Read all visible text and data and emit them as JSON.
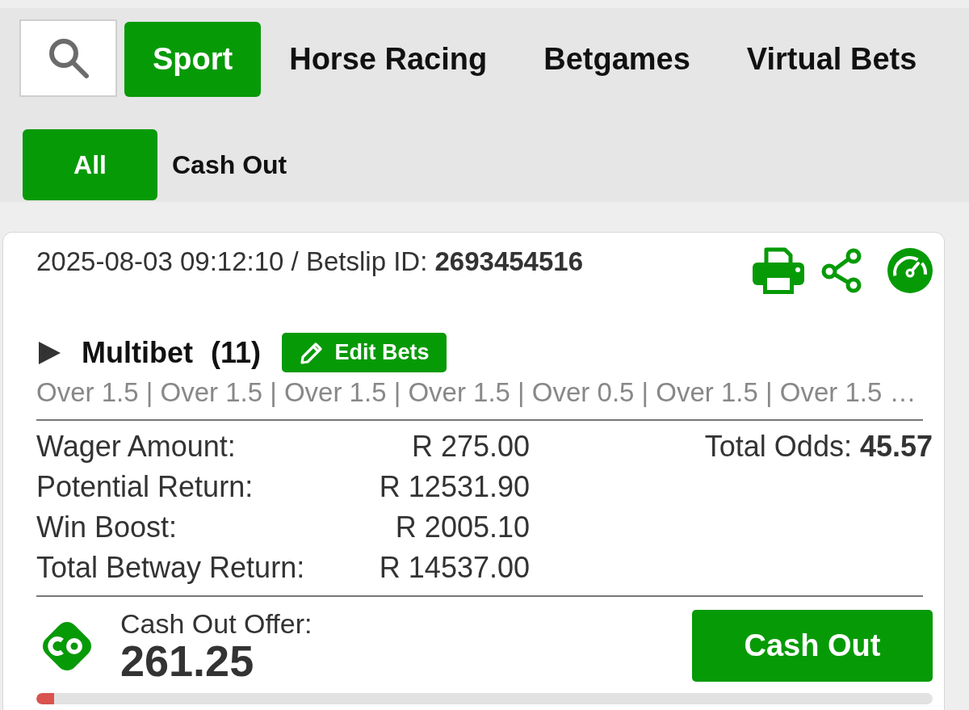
{
  "nav_tabs": [
    {
      "label": "Sport",
      "selected": true
    },
    {
      "label": "Horse Racing",
      "selected": false
    },
    {
      "label": "Betgames",
      "selected": false
    },
    {
      "label": "Virtual Bets",
      "selected": false
    }
  ],
  "filter_tabs": [
    {
      "label": "All",
      "selected": true
    },
    {
      "label": "Cash Out",
      "selected": false
    }
  ],
  "bet": {
    "header": "2025-08-03 09:12:10 / Betslip ID: **2693454516**",
    "expanded": false,
    "type": "Multibet",
    "count": "(11)",
    "edit_button": "Edit Bets",
    "selections": "Over 1.5 | Over 1.5 | Over 1.5 | Over 1.5 | Over 0.5 | Over 1.5 | Over 1.5 …",
    "summary": [
      {
        "label": "Wager Amount:",
        "value": "R 275.00"
      },
      {
        "label": "Potential Return:",
        "value": "R 12531.90"
      },
      {
        "label": "Win Boost:",
        "value": "R 2005.10"
      },
      {
        "label": "Total Betway Return:",
        "value": "R 14537.00"
      }
    ],
    "total_odds": "Total Odds: **45.57**",
    "cash_out": {
      "label": "Cash Out Offer:",
      "amount": "261.25",
      "button": "Cash Out",
      "level": 0.02
    }
  }
}
